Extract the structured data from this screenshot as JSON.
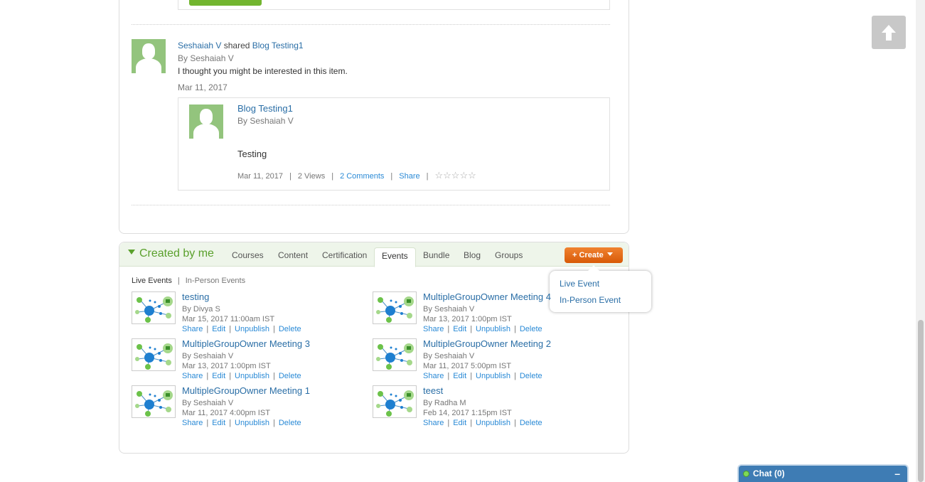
{
  "share": {
    "user": "Seshaiah V",
    "verb": " shared ",
    "item": "Blog Testing1",
    "by": "By Seshaiah V",
    "message": "I thought you might be interested in this item.",
    "date": "Mar 11, 2017"
  },
  "card": {
    "title": "Blog Testing1",
    "by": "By Seshaiah V",
    "body": "Testing",
    "date": "Mar 11, 2017",
    "views": "2 Views",
    "comments": "2 Comments",
    "share": "Share",
    "separator": "|",
    "rating_stars": "☆☆☆☆☆"
  },
  "created": {
    "title": "Created by me",
    "tabs": [
      {
        "label": "Courses"
      },
      {
        "label": "Content"
      },
      {
        "label": "Certification"
      },
      {
        "label": "Events"
      },
      {
        "label": "Bundle"
      },
      {
        "label": "Blog"
      },
      {
        "label": "Groups"
      }
    ],
    "active_tab": "Events",
    "create_label": "+ Create",
    "dropdown": [
      {
        "label": "Live Event"
      },
      {
        "label": "In-Person Event"
      }
    ],
    "subtabs": {
      "live": "Live Events",
      "separator": "|",
      "in_person": "In-Person Events"
    },
    "actions": {
      "share": "Share",
      "edit": "Edit",
      "unpublish": "Unpublish",
      "delete": "Delete",
      "separator": "|"
    },
    "events": [
      {
        "title": "testing",
        "by": "By Divya S",
        "date": "Mar 15, 2017 11:00am IST"
      },
      {
        "title": "MultipleGroupOwner Meeting 4",
        "by": "By Seshaiah V",
        "date": "Mar 13, 2017 1:00pm IST"
      },
      {
        "title": "MultipleGroupOwner Meeting 3",
        "by": "By Seshaiah V",
        "date": "Mar 13, 2017 1:00pm IST"
      },
      {
        "title": "MultipleGroupOwner Meeting 2",
        "by": "By Seshaiah V",
        "date": "Mar 11, 2017 5:00pm IST"
      },
      {
        "title": "MultipleGroupOwner Meeting 1",
        "by": "By Seshaiah V",
        "date": "Mar 11, 2017 4:00pm IST"
      },
      {
        "title": "teest",
        "by": "By Radha M",
        "date": "Feb 14, 2017 1:15pm IST"
      }
    ]
  },
  "chat": {
    "label": "Chat  (0)",
    "minimize": "–"
  },
  "icons": {
    "scroll_top": "arrow-up-icon",
    "event_thumb": "network-event-icon",
    "avatar": "user-avatar-icon"
  },
  "colors": {
    "link": "#2a6ea6",
    "green": "#5aa02c",
    "create_button": "#e8700f",
    "chat_bar": "#3e7cb4"
  }
}
